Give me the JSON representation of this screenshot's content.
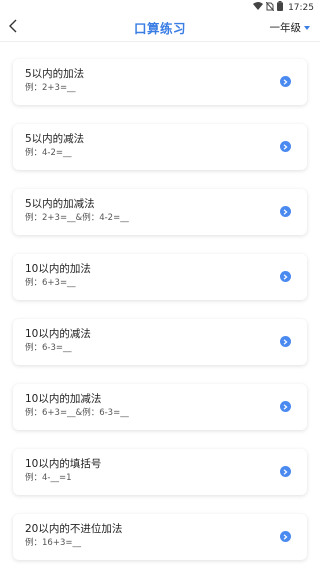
{
  "status_bar": {
    "time": "17:25"
  },
  "header": {
    "title": "口算练习",
    "grade": "一年级",
    "back_icon": "chevron-left-icon"
  },
  "colors": {
    "accent": "#3a7ee4",
    "go_icon": "#4a8af0"
  },
  "cards": [
    {
      "title": "5以内的加法",
      "example": "例：2+3=__"
    },
    {
      "title": "5以内的减法",
      "example": "例：4-2=__"
    },
    {
      "title": "5以内的加减法",
      "example": "例：2+3=__&例：4-2=__"
    },
    {
      "title": "10以内的加法",
      "example": "例：6+3=__"
    },
    {
      "title": "10以内的减法",
      "example": "例：6-3=__"
    },
    {
      "title": "10以内的加减法",
      "example": "例：6+3=__&例：6-3=__"
    },
    {
      "title": "10以内的填括号",
      "example": "例：4-__=1"
    },
    {
      "title": "20以内的不进位加法",
      "example": "例：16+3=__"
    }
  ]
}
